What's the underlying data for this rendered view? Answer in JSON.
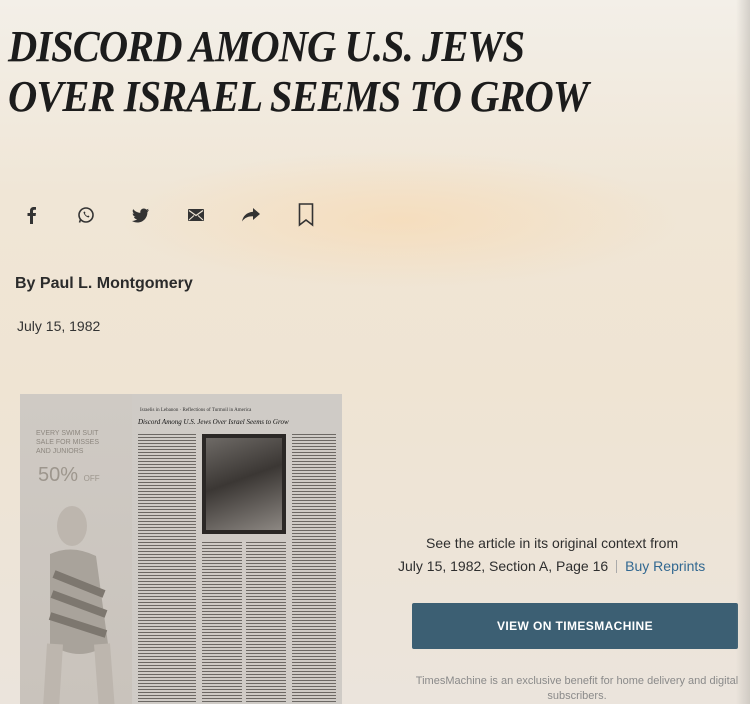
{
  "article": {
    "headline_line1": "DISCORD AMONG U.S. JEWS",
    "headline_line2": "OVER ISRAEL SEEMS TO GROW",
    "byline": "By Paul L. Montgomery",
    "date": "July 15, 1982"
  },
  "share": {
    "icons": [
      "facebook-icon",
      "whatsapp-icon",
      "twitter-icon",
      "email-icon",
      "share-arrow-icon",
      "bookmark-icon"
    ]
  },
  "scan": {
    "ad_text": "EVERY SWIM SUIT SALE FOR MISSES AND JUNIORS",
    "ad_percent": "50%",
    "ad_off": "OFF",
    "header_small": "Israelis in Lebanon · Reflections of Turmoil in America",
    "headline": "Discord Among U.S. Jews Over Israel Seems to Grow"
  },
  "context": {
    "line1": "See the article in its original context from",
    "line2": "July 15, 1982, Section A, Page 16",
    "reprint_label": "Buy Reprints"
  },
  "timesmachine": {
    "button_label": "VIEW ON TIMESMACHINE",
    "note": "TimesMachine is an exclusive benefit for home delivery and digital subscribers."
  }
}
